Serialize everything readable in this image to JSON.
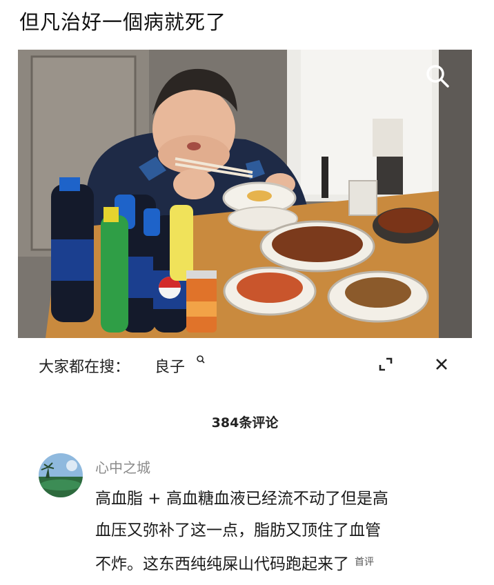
{
  "post": {
    "title": "但凡治好一個病就死了"
  },
  "media": {
    "search_icon": "magnifier-icon"
  },
  "search_bar": {
    "prefix": "大家都在搜：",
    "keyword": "良子",
    "keyword_icon": "search-icon",
    "expand_icon": "expand-icon",
    "close_icon": "close-icon"
  },
  "comments": {
    "count_label": "384条评论",
    "items": [
      {
        "username": "心中之城",
        "lines": [
          "高血脂 + 高血糖血液已经流不动了但是高",
          "血压又弥补了这一点，脂肪又顶住了血管",
          "不炸。这东西纯纯屎山代码跑起来了"
        ],
        "badge": "首评"
      }
    ]
  },
  "colors": {
    "text_primary": "#111111",
    "text_secondary": "#8a8a8a",
    "table": "#c98a3e",
    "pepsi_blue": "#1b3f8f",
    "sprite_green": "#2f9e46"
  }
}
